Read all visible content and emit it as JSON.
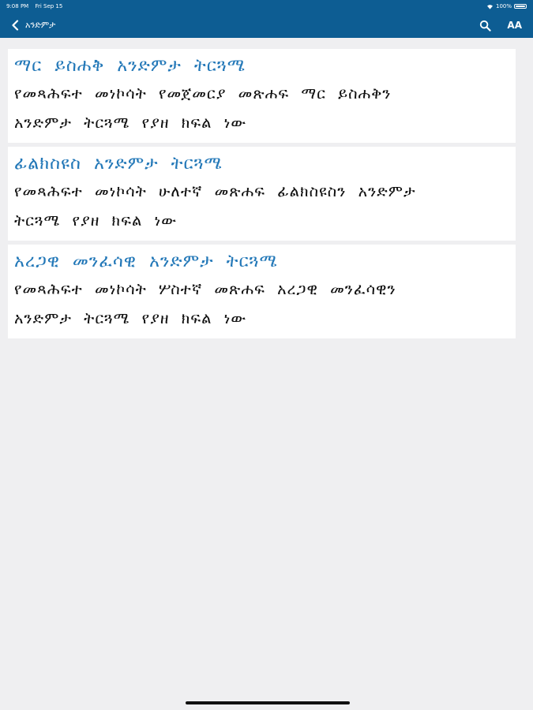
{
  "status_bar": {
    "time": "9:08 PM",
    "date": "Fri Sep 15",
    "battery": "100%",
    "battery_level": 1.0
  },
  "nav": {
    "back_label": "አንድምታ",
    "back_icon": "chevron-left-icon",
    "search_icon": "search-icon",
    "font_size_label": "AA"
  },
  "colors": {
    "bar": "#0d5d93",
    "title": "#2378b8",
    "background": "#efeff1"
  },
  "items": [
    {
      "title": "ማር ይስሐቅ አንድምታ ትርጓሜ",
      "desc_line1": "የመጻሕፍተ መነኮሳት የመጀመርያ መጽሐፍ ማር ይስሐቅን",
      "desc_line2": "አንድምታ ትርጓሜ የያዘ ክፍል ነው"
    },
    {
      "title": "ፊልክስዩስ አንድምታ ትርጓሜ",
      "desc_line1": "የመጻሕፍተ መነኮሳት ሁለተኛ መጽሐፍ ፊልክስዩስን አንድምታ",
      "desc_line2": "ትርጓሜ የያዘ ክፍል ነው"
    },
    {
      "title": "አረጋዊ መንፈሳዊ አንድምታ ትርጓሜ",
      "desc_line1": "የመጻሕፍተ መነኮሳት ሦስተኛ መጽሐፍ አረጋዊ መንፈሳዊን",
      "desc_line2": "አንድምታ ትርጓሜ የያዘ ክፍል ነው"
    }
  ]
}
